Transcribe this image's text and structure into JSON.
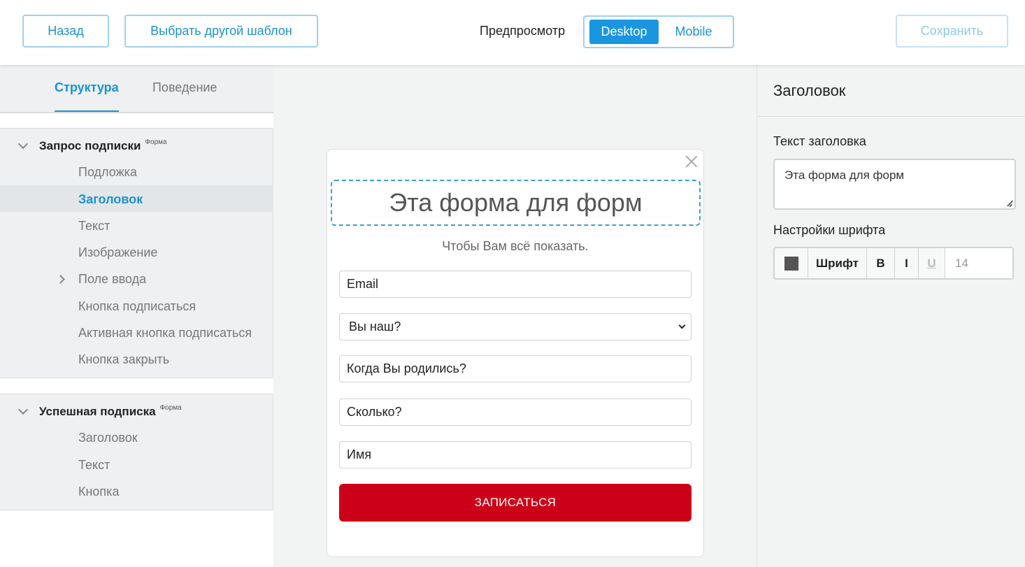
{
  "toolbar": {
    "back_label": "Назад",
    "choose_template_label": "Выбрать другой шаблон",
    "preview_label": "Предпросмотр",
    "preview_desktop": "Desktop",
    "preview_mobile": "Mobile",
    "save_label": "Сохранить"
  },
  "left_panel": {
    "tabs": [
      {
        "label": "Структура",
        "active": true
      },
      {
        "label": "Поведение",
        "active": false
      }
    ],
    "groups": [
      {
        "title": "Запрос подписки",
        "badge": "Форма",
        "items": [
          {
            "label": "Подложка"
          },
          {
            "label": "Заголовок",
            "selected": true
          },
          {
            "label": "Текст"
          },
          {
            "label": "Изображение"
          },
          {
            "label": "Поле ввода",
            "expandable": true
          },
          {
            "label": "Кнопка подписаться"
          },
          {
            "label": "Активная кнопка подписаться"
          },
          {
            "label": "Кнопка закрыть"
          }
        ]
      },
      {
        "title": "Успешная подписка",
        "badge": "Форма",
        "items": [
          {
            "label": "Заголовок"
          },
          {
            "label": "Текст"
          },
          {
            "label": "Кнопка"
          }
        ]
      }
    ]
  },
  "form_preview": {
    "headline": "Эта форма для форм",
    "subtitle": "Чтобы Вам всё показать.",
    "fields": [
      {
        "placeholder": "Email"
      },
      {
        "placeholder": "Вы наш?",
        "type": "select"
      },
      {
        "placeholder": "Когда Вы родились?"
      },
      {
        "placeholder": "Сколько?"
      },
      {
        "placeholder": "Имя"
      }
    ],
    "submit_label": "ЗАПИСАТЬСЯ",
    "submit_color": "#cc0018"
  },
  "right_panel": {
    "title": "Заголовок",
    "headline_text_label": "Текст заголовка",
    "headline_text_value": "Эта форма для форм",
    "font_settings_label": "Настройки шрифта",
    "font_button_label": "Шрифт",
    "bold_label": "B",
    "italic_label": "I",
    "underline_label": "U",
    "font_size_value": "14",
    "font_color": "#555555"
  },
  "colors": {
    "accent": "#1c92d4",
    "accent_border": "#9fd1ec",
    "submit_red": "#cc0018"
  }
}
